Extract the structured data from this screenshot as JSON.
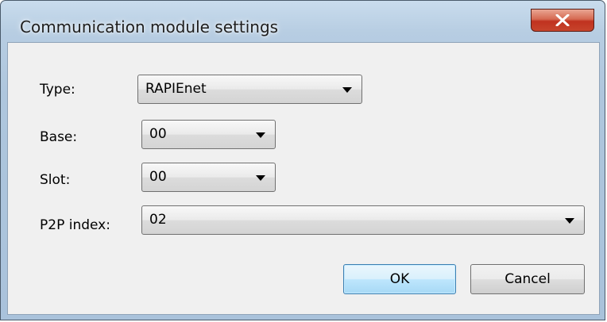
{
  "window": {
    "title": "Communication module settings"
  },
  "fields": {
    "type": {
      "label": "Type:",
      "value": "RAPIEnet"
    },
    "base": {
      "label": "Base:",
      "value": "00"
    },
    "slot": {
      "label": "Slot:",
      "value": "00"
    },
    "p2p": {
      "label": "P2P index:",
      "value": "02"
    }
  },
  "buttons": {
    "ok": "OK",
    "cancel": "Cancel"
  },
  "colors": {
    "titlebar": "#b7cde2",
    "close": "#c7442c",
    "client": "#f0f0f0",
    "ok_border": "#3c7fb1"
  },
  "icons": {
    "close": "close-icon",
    "dropdown": "chevron-down-icon"
  }
}
